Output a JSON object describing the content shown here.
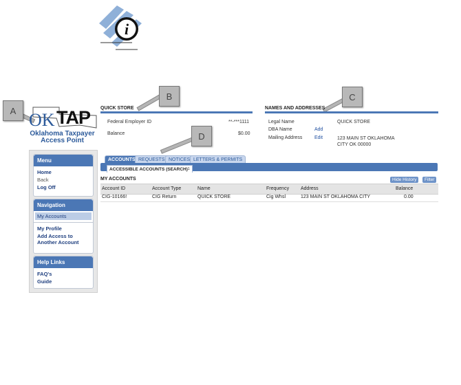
{
  "callouts": [
    "A",
    "B",
    "C",
    "D"
  ],
  "logo": {
    "ok": "OK",
    "tap": "TAP",
    "subtitle_line1": "Oklahoma Taxpayer",
    "subtitle_line2": "Access Point"
  },
  "menu": {
    "title": "Menu",
    "home": "Home",
    "back": "Back",
    "logoff": "Log Off"
  },
  "navigation": {
    "title": "Navigation",
    "my_accounts": "My Accounts",
    "my_profile": "My Profile",
    "add_access_1": "Add Access to",
    "add_access_2": "Another Account"
  },
  "help": {
    "title": "Help Links",
    "faqs": "FAQ's",
    "guide": "Guide"
  },
  "account": {
    "title": "QUICK STORE",
    "fein_label": "Federal Employer ID",
    "fein_value": "**-***1111",
    "balance_label": "Balance",
    "balance_value": "$0.00"
  },
  "names": {
    "title": "NAMES AND ADDRESSES",
    "legal_label": "Legal Name",
    "legal_value": "QUICK STORE",
    "dba_label": "DBA Name",
    "dba_action": "Add",
    "mailing_label": "Mailing Address",
    "mailing_action": "Edit",
    "mailing_line1": "123 MAIN ST OKLAHOMA",
    "mailing_line2": "CITY OK 00000"
  },
  "tabs": [
    "ACCOUNTS",
    "REQUESTS",
    "NOTICES",
    "LETTERS & PERMITS"
  ],
  "subtab": "ACCESSIBLE ACCOUNTS (SEARCH)",
  "subtab_mark": "1",
  "my_accounts": {
    "title": "MY ACCOUNTS",
    "hide_history": "Hide History",
    "filter": "Filter",
    "columns": [
      "Account ID",
      "Account Type",
      "Name",
      "Frequency",
      "Address",
      "Balance"
    ],
    "row": {
      "id": "CIG-10166!",
      "type": "CIG Return",
      "name": "QUICK STORE",
      "frequency": "Cig Whsl",
      "address": "123 MAIN ST OKLAHOMA CITY",
      "balance": "0.00"
    }
  }
}
